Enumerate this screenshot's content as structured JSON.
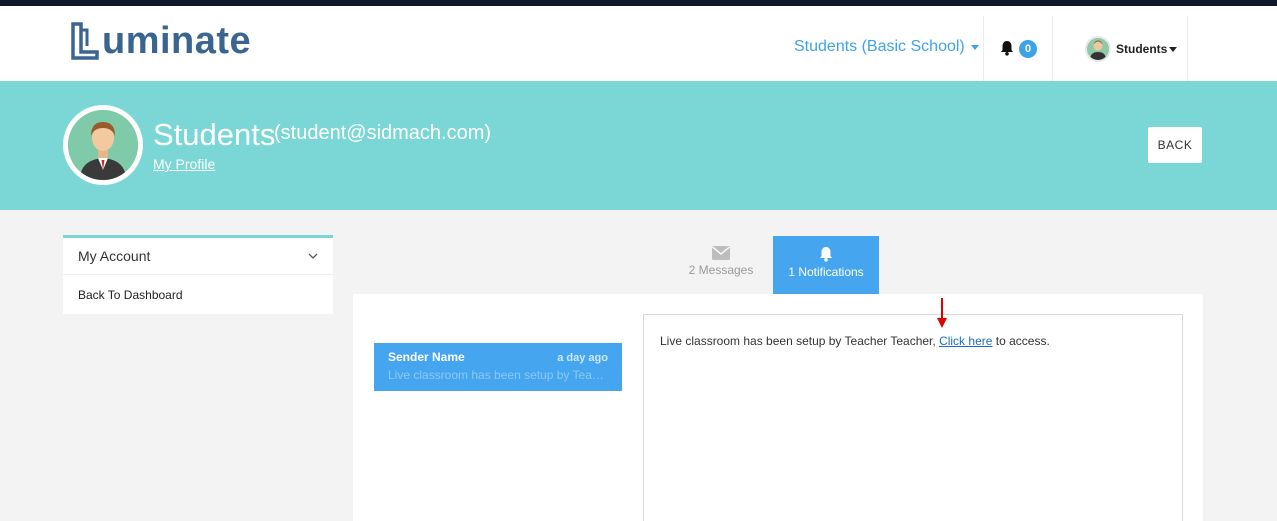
{
  "brand": {
    "logo_text": "uminate",
    "logo_mark": "L"
  },
  "nav": {
    "role_label": "Students (Basic School)",
    "notification_count": "0",
    "user_label": "Students"
  },
  "banner": {
    "name": "Students",
    "email": "(student@sidmach.com)",
    "profile_link": "My Profile",
    "back_label": "BACK",
    "background_color": "#7bd7d6"
  },
  "sidebar": {
    "section_title": "My Account",
    "items": [
      {
        "label": "Back To Dashboard"
      }
    ]
  },
  "tabs": [
    {
      "label": "2 Messages",
      "icon": "envelope-icon",
      "active": false
    },
    {
      "label": "1 Notifications",
      "icon": "bell-icon",
      "active": true
    }
  ],
  "notifications": [
    {
      "sender": "Sender Name",
      "time": "a day ago",
      "preview": "Live classroom has been setup by Teacher Teacher, Click here to access."
    }
  ],
  "detail": {
    "text_before": "Live classroom has been setup by Teacher Teacher, ",
    "link_text": "Click here",
    "text_after": " to access."
  },
  "accent_color": "#45a6ef"
}
